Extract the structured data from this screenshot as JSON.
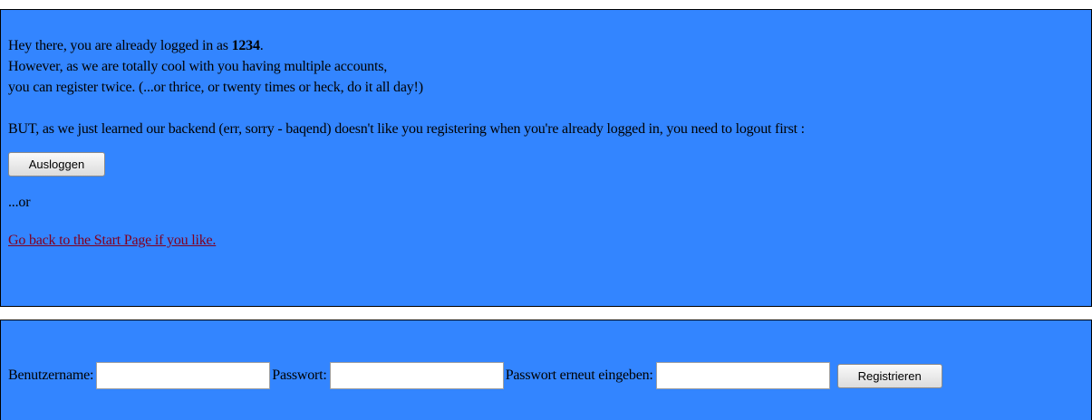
{
  "notice": {
    "line1_prefix": "Hey there, you are already logged in as ",
    "username": "1234",
    "line1_suffix": ".",
    "line2": "However, as we are totally cool with you having multiple accounts,",
    "line3": "you can register twice. (...or thrice, or twenty times or heck, do it all day!)",
    "line4": "BUT, as we just learned our backend (err, sorry - baqend) doesn't like you registering when you're already logged in, you need to logout first :",
    "logout_button": "Ausloggen",
    "or_text": "...or",
    "start_page_link": "Go back to the Start Page if you like."
  },
  "register_form": {
    "username_label": "Benutzername:",
    "username_value": "",
    "password_label": "Passwort:",
    "password_value": "",
    "password_repeat_label": "Passwort erneut eingeben:",
    "password_repeat_value": "",
    "submit_button": "Registrieren"
  },
  "colors": {
    "panel_background": "#3385ff",
    "link": "#800020"
  }
}
